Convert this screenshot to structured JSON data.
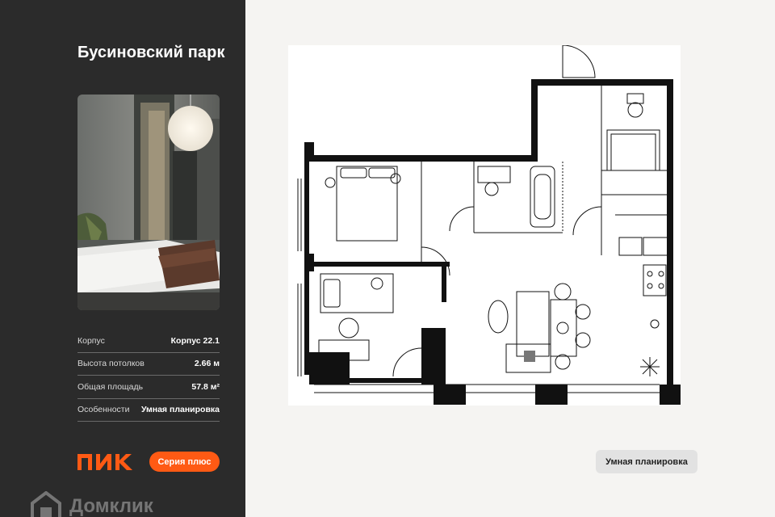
{
  "sidebar": {
    "title": "Бусиновский парк",
    "specs": [
      {
        "label": "Корпус",
        "value": "Корпус 22.1"
      },
      {
        "label": "Высота потолков",
        "value": "2.66 м"
      },
      {
        "label": "Общая площадь",
        "value": "57.8 м²"
      },
      {
        "label": "Особенности",
        "value": "Умная планировка"
      }
    ],
    "brand_logo": "ПИК",
    "series_button": "Серия плюс",
    "watermark": "Домклик"
  },
  "plan": {
    "badge": "Умная планировка"
  },
  "colors": {
    "sidebar_bg": "#2b2b2b",
    "accent": "#ff5a14",
    "page_bg": "#f5f4f2",
    "badge_bg": "#e2e2e2"
  },
  "icons": [
    "pik-logo",
    "domclick-icon",
    "bed-icon",
    "toilet-icon",
    "bathtub-icon",
    "shower-icon",
    "sink-icon",
    "stove-icon",
    "sofa-icon",
    "table-icon",
    "plant-icon"
  ]
}
